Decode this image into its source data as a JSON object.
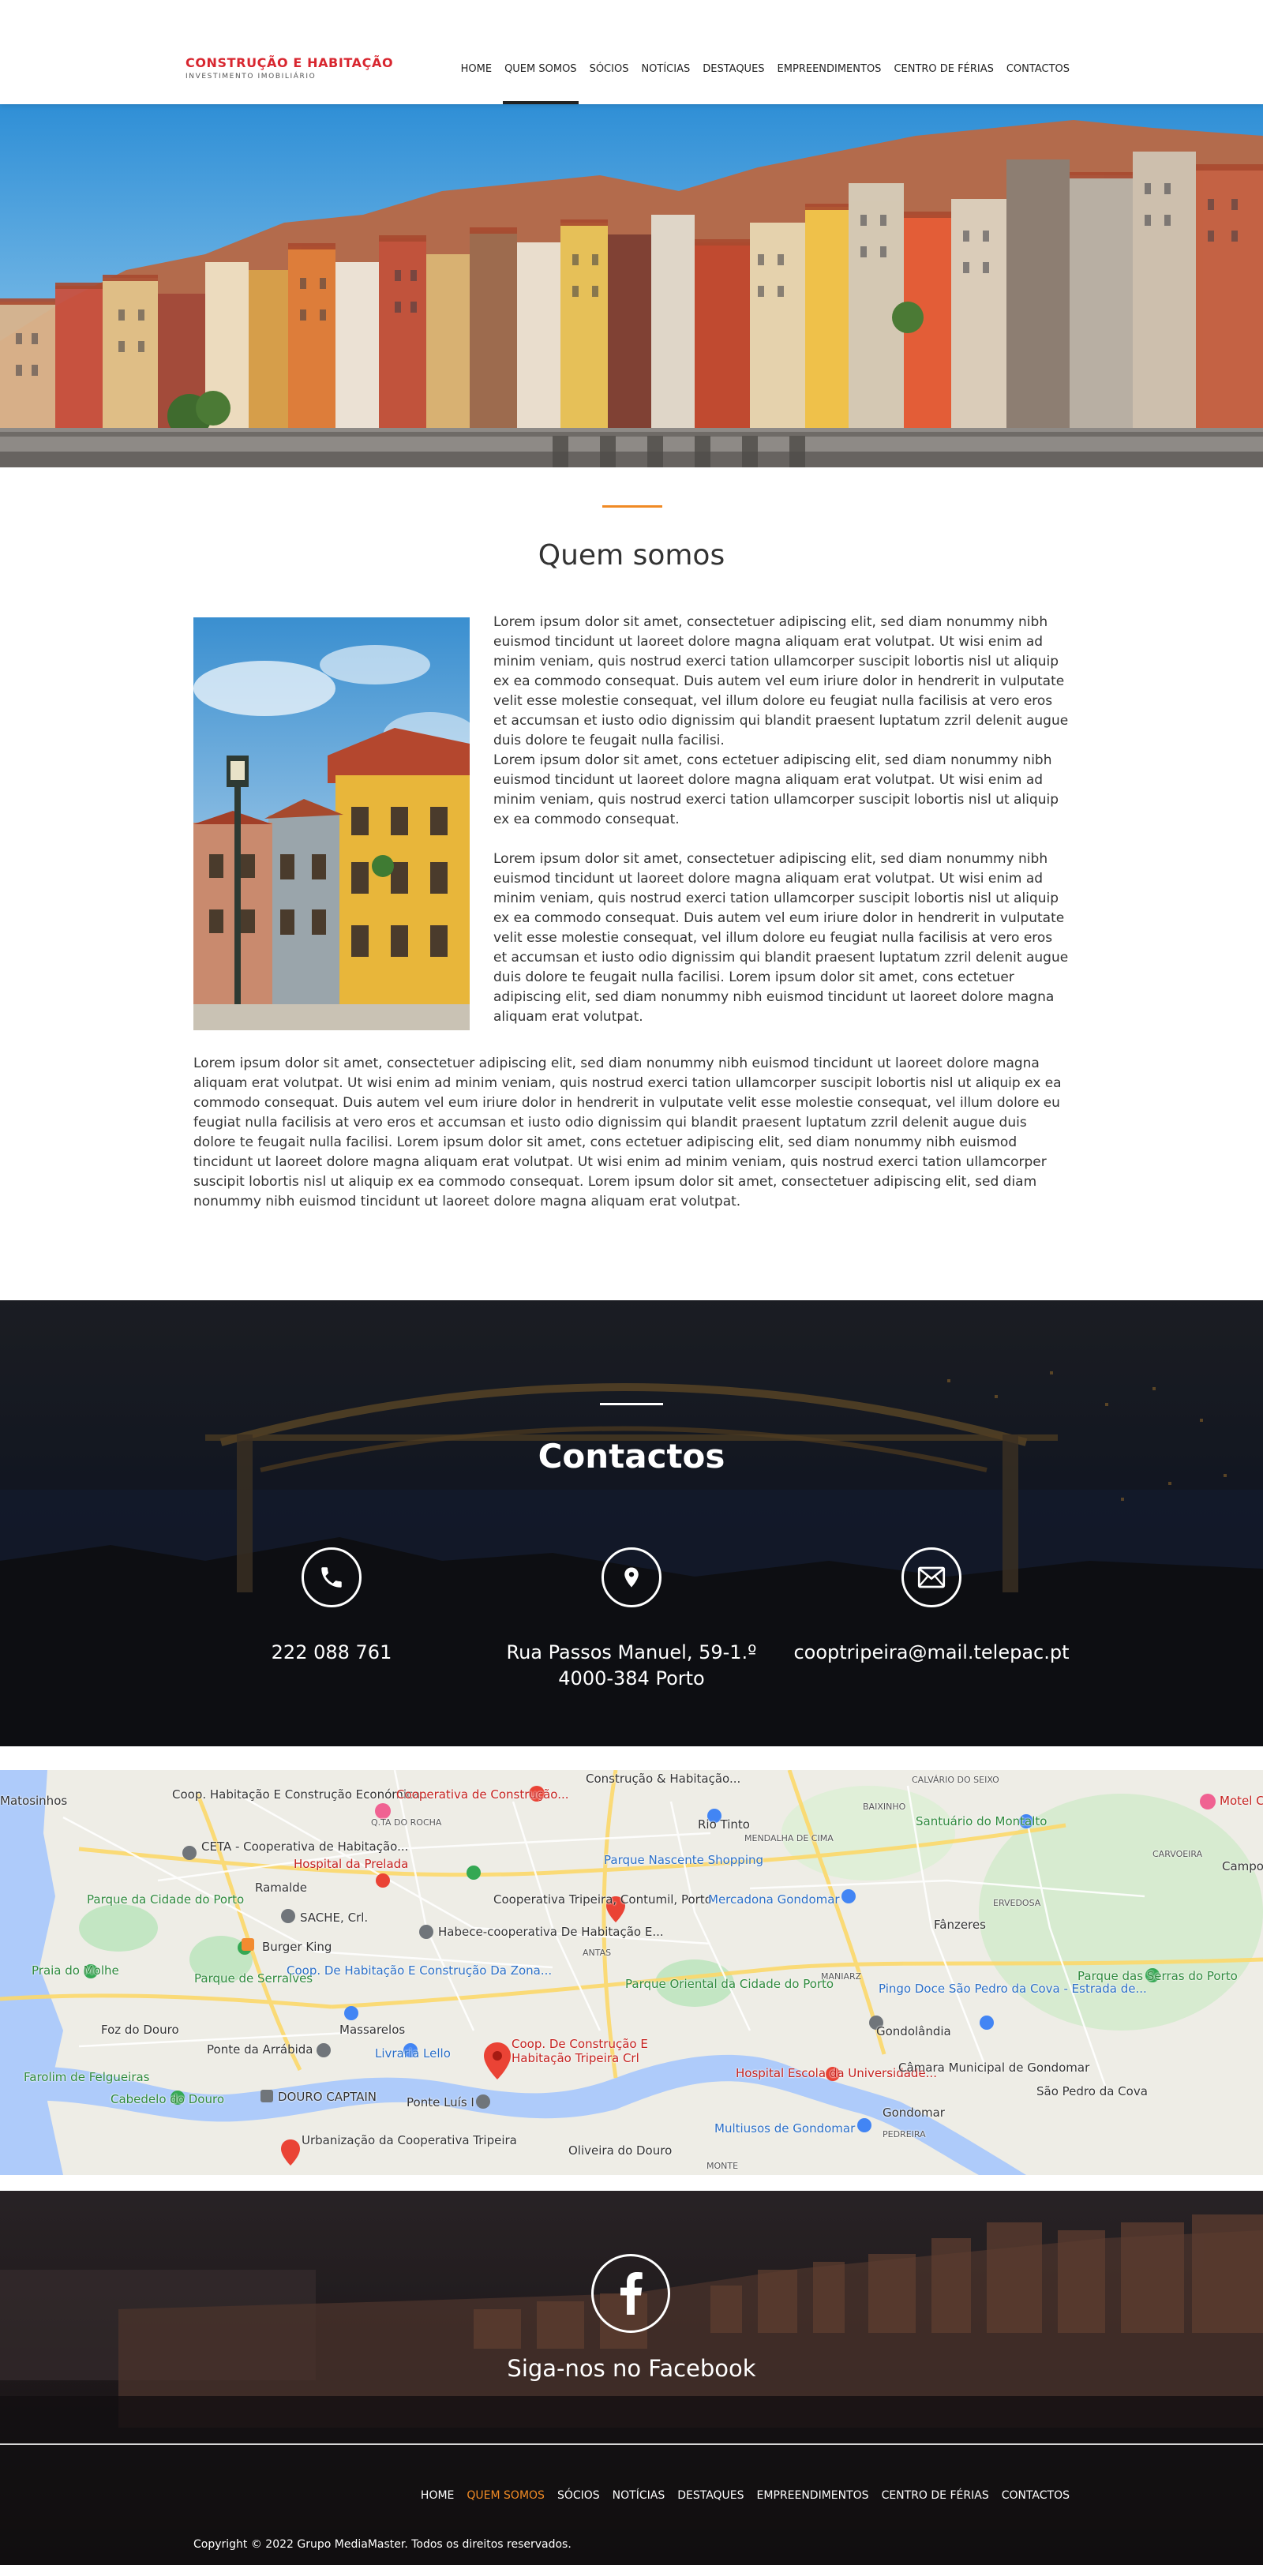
{
  "brand": {
    "title": "CONSTRUÇÃO E HABITAÇÃO",
    "subtitle": "INVESTIMENTO IMOBILIÁRIO",
    "accent_color": "#d8262f"
  },
  "nav": {
    "items": [
      {
        "label": "HOME",
        "active": false
      },
      {
        "label": "QUEM SOMOS",
        "active": true
      },
      {
        "label": "SÓCIOS",
        "active": false
      },
      {
        "label": "NOTÍCIAS",
        "active": false
      },
      {
        "label": "DESTAQUES",
        "active": false
      },
      {
        "label": "EMPREENDIMENTOS",
        "active": false
      },
      {
        "label": "CENTRO DE FÉRIAS",
        "active": false
      },
      {
        "label": "CONTACTOS",
        "active": false
      }
    ]
  },
  "about": {
    "title": "Quem somos",
    "accent_color": "#f08a24",
    "paragraphs": [
      "Lorem ipsum dolor sit amet, consectetuer adipiscing elit, sed diam nonummy nibh euismod tincidunt ut laoreet dolore magna aliquam erat volutpat. Ut wisi enim ad minim veniam, quis nostrud exerci tation ullamcorper suscipit lobortis nisl ut aliquip ex ea commodo consequat. Duis autem vel eum iriure dolor in hendrerit in vulputate velit esse molestie consequat, vel illum dolore eu feugiat nulla facilisis at vero eros et accumsan et iusto odio dignissim qui blandit praesent luptatum zzril delenit augue duis dolore te feugait nulla facilisi.",
      "Lorem ipsum dolor sit amet, cons ectetuer adipiscing elit, sed diam nonummy nibh euismod tincidunt ut laoreet dolore magna aliquam erat volutpat. Ut wisi enim ad minim veniam, quis nostrud exerci tation ullamcorper suscipit lobortis nisl ut aliquip ex ea commodo consequat.",
      "Lorem ipsum dolor sit amet, consectetuer adipiscing elit, sed diam nonummy nibh euismod tincidunt ut laoreet dolore magna aliquam erat volutpat. Ut wisi enim ad minim veniam, quis nostrud exerci tation ullamcorper suscipit lobortis nisl ut aliquip ex ea commodo consequat. Duis autem vel eum iriure dolor in hendrerit in vulputate velit esse molestie consequat, vel illum dolore eu feugiat nulla facilisis at vero eros et accumsan et iusto odio dignissim qui blandit praesent luptatum zzril delenit augue duis dolore te feugait nulla facilisi. Lorem ipsum dolor sit amet, cons ectetuer adipiscing elit, sed diam nonummy nibh euismod tincidunt ut laoreet dolore magna aliquam erat volutpat."
    ],
    "full_paragraph": "Lorem ipsum dolor sit amet, consectetuer adipiscing elit, sed diam nonummy nibh euismod tincidunt ut laoreet dolore magna aliquam erat volutpat. Ut wisi enim ad minim veniam, quis nostrud exerci tation ullamcorper suscipit lobortis nisl ut aliquip ex ea commodo consequat. Duis autem vel eum iriure dolor in hendrerit in vulputate velit esse molestie consequat, vel illum dolore eu feugiat nulla facilisis at vero eros et accumsan et iusto odio dignissim qui blandit praesent luptatum zzril delenit augue duis dolore te feugait nulla facilisi. Lorem ipsum dolor sit amet, cons ectetuer adipiscing elit, sed diam nonummy nibh euismod tincidunt ut laoreet dolore magna aliquam erat volutpat. Ut wisi enim ad minim veniam, quis nostrud exerci tation ullamcorper suscipit lobortis nisl ut aliquip ex ea commodo consequat. Lorem ipsum dolor sit amet, consectetuer adipiscing elit, sed diam nonummy nibh euismod tincidunt ut laoreet dolore magna aliquam erat volutpat."
  },
  "contacts": {
    "title": "Contactos",
    "phone": "222 088 761",
    "address_line1": "Rua Passos Manuel, 59-1.º",
    "address_line2": "4000-384 Porto",
    "email": "cooptripeira@mail.telepac.pt",
    "icons": [
      "phone-icon",
      "location-pin-icon",
      "envelope-icon"
    ]
  },
  "map": {
    "labels": [
      "Coop. Habitação E Construção Económica...",
      "Cooperativa de Construção...",
      "Construção & Habitação...",
      "Rio Tinto",
      "CALVÁRIO DO SEIXO",
      "Santuário do Montalto",
      "CETA - Cooperativa de Habitação...",
      "Hospital da Prelada",
      "Parque Nascente Shopping",
      "Ramalde",
      "SACHE, Crl.",
      "Cooperativa Tripeira, Contumil, Porto",
      "Mercadona Gondomar",
      "Fânzeres",
      "Habece-cooperativa De Habitação E...",
      "Burger King",
      "Coop. De Habitação E Construção Da Zona...",
      "Parque Oriental da Cidade do Porto",
      "Pingo Doce São Pedro da Cova - Estrada de...",
      "Parque das Serras do Porto",
      "Foz do Douro",
      "Massarelos",
      "Gondolândia",
      "Ponte da Arrábida",
      "Livraria Lello",
      "Coop. De Construção E Habitação Tripeira Crl",
      "Hospital Escola da Universidade...",
      "Câmara Municipal de Gondomar",
      "Farolim de Felgueiras",
      "Cabedelo do Douro",
      "DOURO CAPTAIN",
      "Ponte Luís I",
      "Multiusos de Gondomar",
      "Gondomar",
      "São Pedro da Cova",
      "Urbanização da Cooperativa Tripeira",
      "Oliveira do Douro",
      "MONTE",
      "Matosinhos",
      "Parque da Cidade do Porto",
      "Praia do Molhe",
      "Parque de Serralves",
      "Q.TA DO ROCHA",
      "MENDALHA DE CIMA",
      "CARVOEIRA",
      "Campo",
      "ERVEDOSA",
      "MANIARZ",
      "PEDREIRA",
      "ANTAS",
      "BAIXINHO",
      "Motel C"
    ]
  },
  "facebook": {
    "cta": "Siga-nos no Facebook"
  },
  "footer": {
    "nav": [
      {
        "label": "HOME",
        "active": false
      },
      {
        "label": "QUEM SOMOS",
        "active": true
      },
      {
        "label": "SÓCIOS",
        "active": false
      },
      {
        "label": "NOTÍCIAS",
        "active": false
      },
      {
        "label": "DESTAQUES",
        "active": false
      },
      {
        "label": "EMPREENDIMENTOS",
        "active": false
      },
      {
        "label": "CENTRO DE FÉRIAS",
        "active": false
      },
      {
        "label": "CONTACTOS",
        "active": false
      }
    ],
    "copyright": "Copyright © 2022 Grupo MediaMaster. Todos os direitos reservados."
  }
}
